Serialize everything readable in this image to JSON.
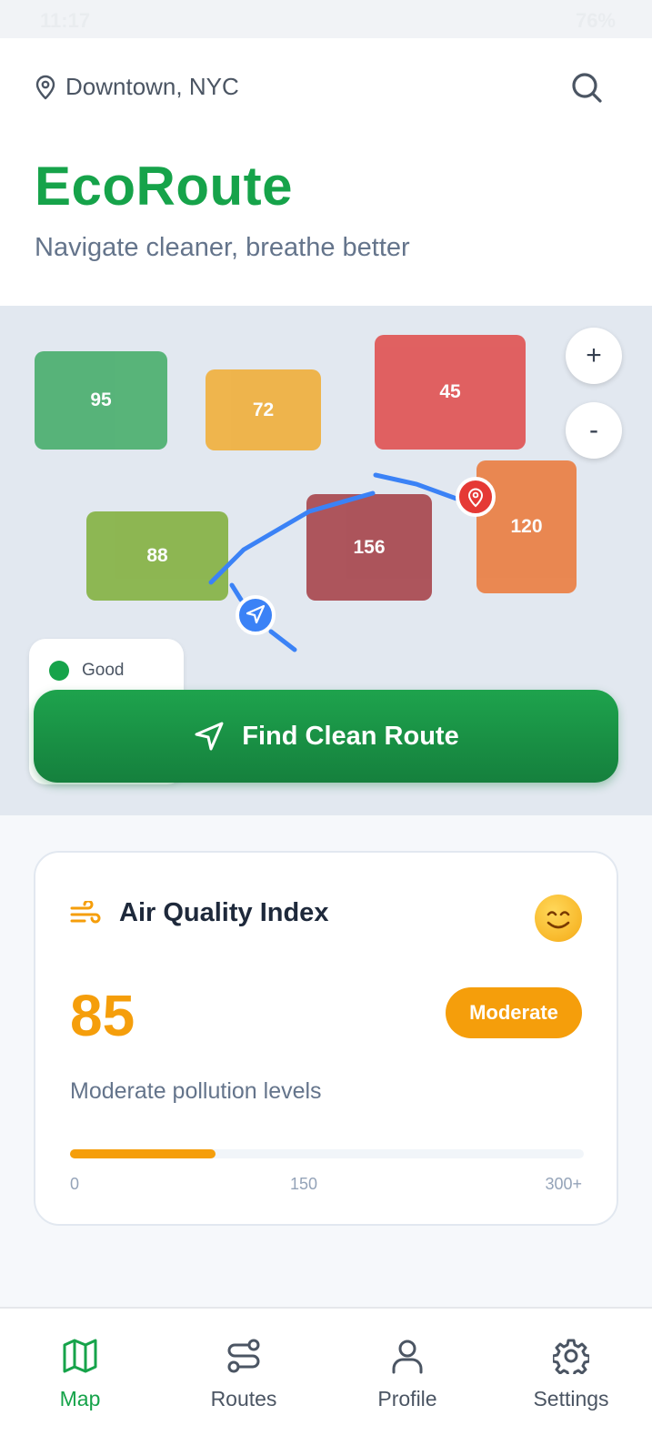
{
  "status_bar": {
    "time": "11:17",
    "battery": "76%"
  },
  "header": {
    "location": "Downtown, NYC",
    "app_title": "EcoRoute",
    "tagline": "Navigate cleaner, breathe better"
  },
  "map": {
    "zones": [
      {
        "value": "95",
        "color": "#4caf6f"
      },
      {
        "value": "72",
        "color": "#f0b03f"
      },
      {
        "value": "45",
        "color": "#e05555"
      },
      {
        "value": "88",
        "color": "#86b245"
      },
      {
        "value": "156",
        "color": "#a8484f"
      },
      {
        "value": "120",
        "color": "#ea7f44"
      }
    ],
    "zoom_in": "+",
    "zoom_out": "-",
    "legend": [
      {
        "label": "Good",
        "color": "#16a34a"
      }
    ],
    "cta_label": "Find Clean Route"
  },
  "aqi": {
    "title": "Air Quality Index",
    "value": "85",
    "level": "Moderate",
    "description": "Moderate pollution levels",
    "progress_fraction": 0.283,
    "scale": [
      "0",
      "150",
      "300+"
    ]
  },
  "nav": {
    "items": [
      {
        "label": "Map",
        "icon": "map-icon",
        "active": true
      },
      {
        "label": "Routes",
        "icon": "route-icon",
        "active": false
      },
      {
        "label": "Profile",
        "icon": "user-icon",
        "active": false
      },
      {
        "label": "Settings",
        "icon": "gear-icon",
        "active": false
      }
    ]
  },
  "colors": {
    "brand": "#16a34a",
    "moderate": "#f59e0b",
    "route": "#3b82f6",
    "destination": "#e53935"
  }
}
